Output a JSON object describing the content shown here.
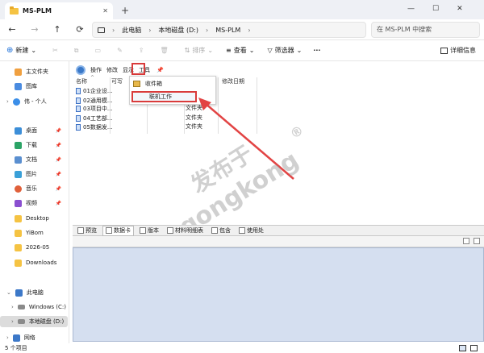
{
  "window": {
    "title": "MS-PLM",
    "new_tab": "+"
  },
  "nav": {
    "back": "←",
    "forward": "→",
    "up": "↑",
    "refresh": "⟳"
  },
  "breadcrumb": [
    "此电脑",
    "本地磁盘 (D:)",
    "MS-PLM"
  ],
  "search": {
    "placeholder": "在 MS-PLM 中搜索"
  },
  "cmdbar": {
    "new": "新建",
    "sort": "排序",
    "view": "查看",
    "filter": "筛选器",
    "more": "···",
    "details": "详细信息"
  },
  "sidebar": [
    {
      "label": "主文件夹",
      "icon": "home-icon"
    },
    {
      "label": "图库",
      "icon": "gallery-icon"
    },
    {
      "label": "伟 - 个人",
      "icon": "cloud-icon"
    },
    {
      "label": "桌面",
      "icon": "desktop-icon"
    },
    {
      "label": "下载",
      "icon": "download-icon"
    },
    {
      "label": "文档",
      "icon": "document-icon"
    },
    {
      "label": "图片",
      "icon": "picture-icon"
    },
    {
      "label": "音乐",
      "icon": "music-icon"
    },
    {
      "label": "视频",
      "icon": "video-icon"
    },
    {
      "label": "Desktop",
      "icon": "folder-icon"
    },
    {
      "label": "YiBom",
      "icon": "folder-icon"
    },
    {
      "label": "2026-05",
      "icon": "folder-icon"
    },
    {
      "label": "Downloads",
      "icon": "folder-icon"
    },
    {
      "label": "此电脑",
      "icon": "pc-icon"
    },
    {
      "label": "Windows (C:)",
      "icon": "drive-icon"
    },
    {
      "label": "本地磁盘 (D:)",
      "icon": "drive-icon"
    },
    {
      "label": "网络",
      "icon": "network-icon"
    }
  ],
  "subtoolbar": {
    "ops": "操作",
    "edit": "修改",
    "display": "显示",
    "tools": "工具"
  },
  "columns": {
    "name": "名称",
    "writable": "可写",
    "c3": "!",
    "modified": "修改日期"
  },
  "rows": [
    {
      "name": "01企业设...",
      "type": "夹"
    },
    {
      "name": "02通用模...",
      "type": "夹"
    },
    {
      "name": "03项目中...",
      "type": "文件夹"
    },
    {
      "name": "04工艺部...",
      "type": "文件夹"
    },
    {
      "name": "05数据发...",
      "type": "文件夹"
    }
  ],
  "dropdown": {
    "item1": "收件箱",
    "item2": "联机工作"
  },
  "panel_tabs": [
    "预览",
    "数据卡",
    "版本",
    "材料明细表",
    "包含",
    "使用处"
  ],
  "watermark": {
    "line1": "发布于",
    "reg": "®",
    "line2": "gongkong"
  },
  "status": {
    "count": "5 个项目"
  }
}
